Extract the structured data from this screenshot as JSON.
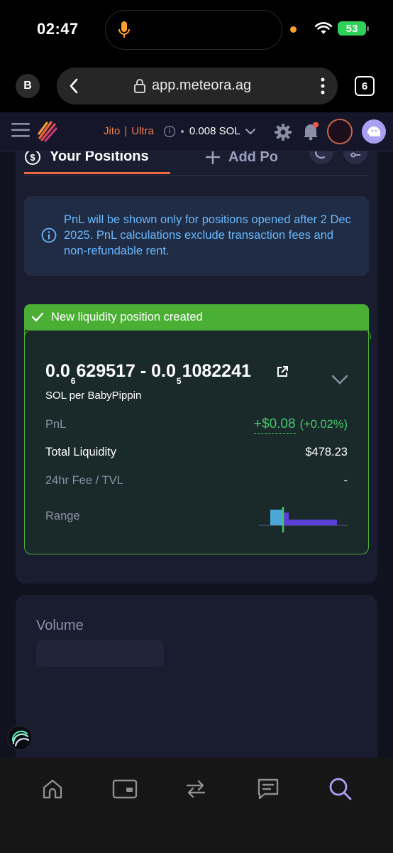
{
  "status_bar": {
    "time": "02:47",
    "battery": "53"
  },
  "browser": {
    "profile_initial": "B",
    "url": "app.meteora.ag",
    "tab_count": "6"
  },
  "header": {
    "jito_label": "Jito",
    "ultra_label": "Ultra",
    "balance": "0.008 SOL",
    "accent_color": "#f37e4b"
  },
  "tabs": {
    "your_positions": "Your Positions",
    "add_position": "Add Po"
  },
  "notice": {
    "text": "PnL will be shown only for positions opened after 2 Dec 2025. PnL calculations exclude transaction fees and non-refundable rent."
  },
  "toast": {
    "text": "New liquidity position created",
    "color": "#4caf35"
  },
  "position": {
    "price_low_int": "0.0",
    "price_low_sub": "6",
    "price_low_digits": "629517",
    "separator": " - ",
    "price_high_int": "0.0",
    "price_high_sub": "5",
    "price_high_digits": "1082241",
    "pair_label": "SOL per BabyPippin",
    "rows": {
      "pnl_label": "PnL",
      "pnl_value": "+$0.08",
      "pnl_percent": "(+0.02%)",
      "liquidity_label": "Total Liquidity",
      "liquidity_value": "$478.23",
      "fee_label": "24hr Fee / TVL",
      "fee_value": "-",
      "range_label": "Range"
    }
  },
  "volume": {
    "label": "Volume"
  },
  "bottom_nav": {
    "items": [
      "home-icon",
      "wallet-card-icon",
      "swap-icon",
      "chat-icon",
      "search-icon"
    ],
    "active": "search-icon"
  }
}
